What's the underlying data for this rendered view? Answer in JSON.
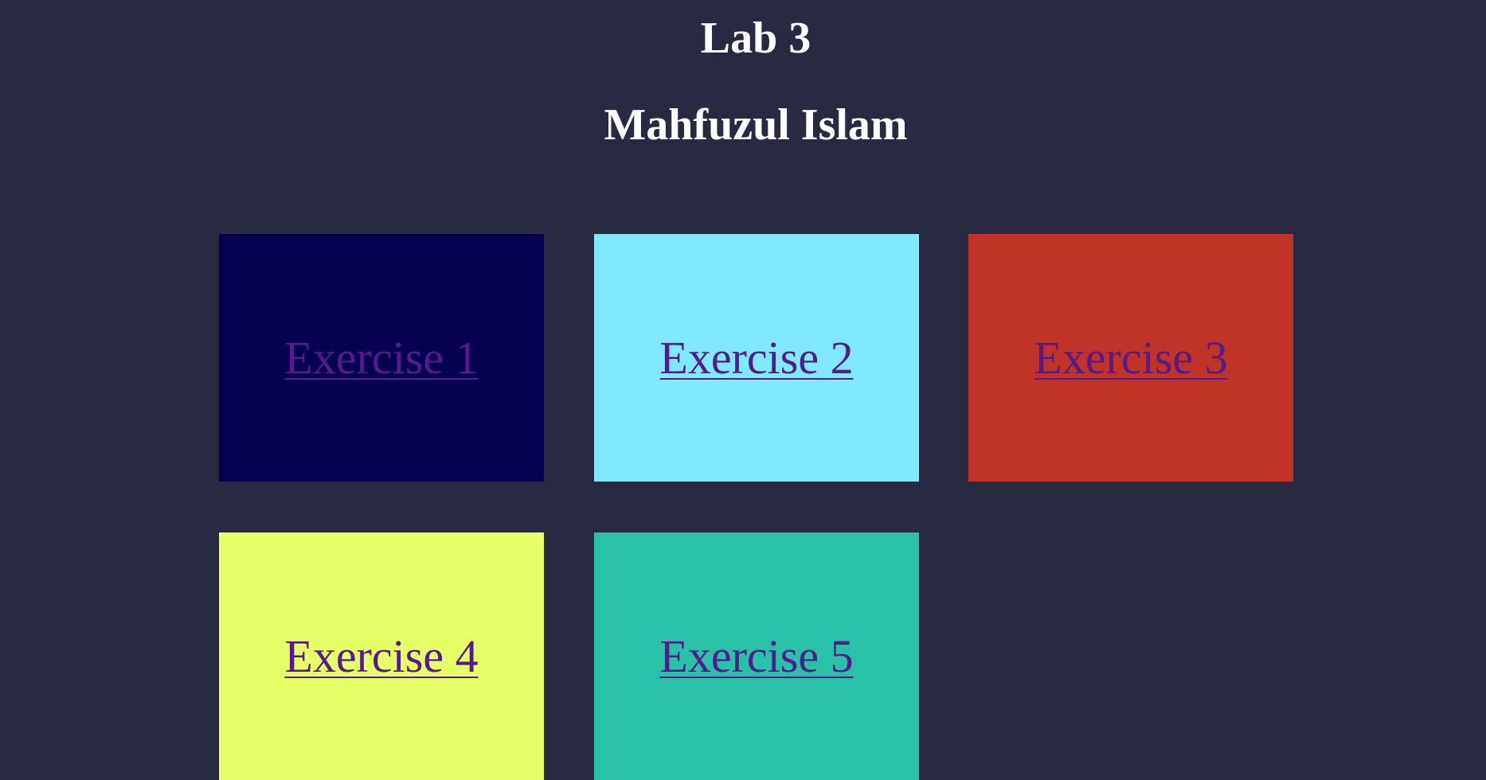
{
  "page": {
    "title": "Lab 3",
    "author": "Mahfuzul Islam",
    "background_color": "#272a40",
    "link_color": "#551a8b"
  },
  "exercises": [
    {
      "label": "Exercise 1",
      "color": "#050050"
    },
    {
      "label": "Exercise 2",
      "color": "#80e9ff"
    },
    {
      "label": "Exercise 3",
      "color": "#c03427"
    },
    {
      "label": "Exercise 4",
      "color": "#e7ff66"
    },
    {
      "label": "Exercise 5",
      "color": "#29c1a8"
    }
  ]
}
